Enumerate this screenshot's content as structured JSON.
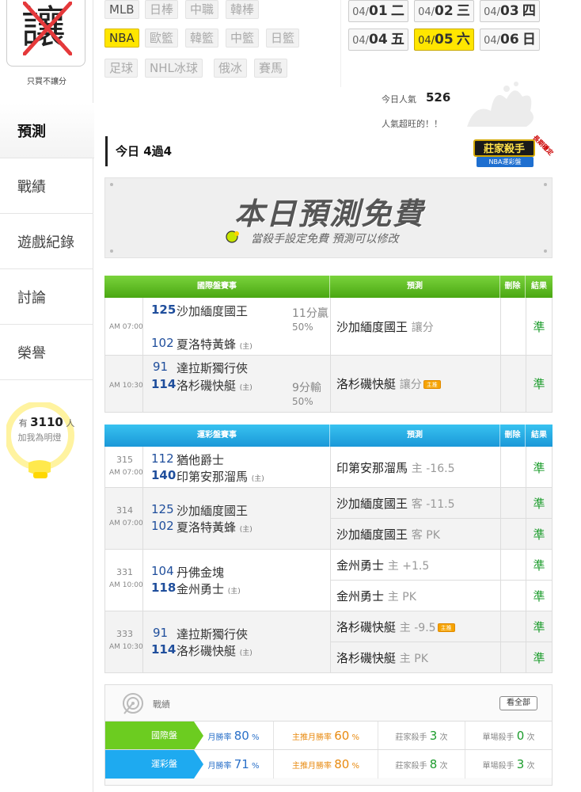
{
  "sidebar": {
    "logo_char": "讓",
    "logo_caption": "只買不讓分",
    "nav": [
      "預測",
      "戰績",
      "遊戲紀錄",
      "討論",
      "榮譽"
    ],
    "fans_prefix": "有",
    "fans_count": "3110",
    "fans_suffix": "人",
    "fans_caption": "加我為明燈"
  },
  "sports": {
    "row1": [
      "MLB",
      "日棒",
      "中職",
      "韓棒"
    ],
    "row2": [
      "NBA",
      "歐籃",
      "韓籃",
      "中籃",
      "日籃"
    ],
    "row3": [
      "足球",
      "NHL冰球",
      "俄冰",
      "賽馬"
    ],
    "active": "NBA"
  },
  "dates": [
    {
      "md": "04/",
      "d": "01",
      "w": "二"
    },
    {
      "md": "04/",
      "d": "02",
      "w": "三"
    },
    {
      "md": "04/",
      "d": "03",
      "w": "四"
    },
    {
      "md": "04/",
      "d": "04",
      "w": "五"
    },
    {
      "md": "04/",
      "d": "05",
      "w": "六"
    },
    {
      "md": "04/",
      "d": "06",
      "w": "日"
    }
  ],
  "popularity": {
    "label": "今日人氣",
    "value": "526",
    "sub": "人氣超旺的！！"
  },
  "today_title": "今日 4過4",
  "badge": {
    "title": "莊家殺手",
    "sub": "NBA運彩盤",
    "ribbon": "長期穩定"
  },
  "banner": {
    "title": "本日預測免費",
    "sub": "當殺手設定免費 預測可以修改"
  },
  "intl_table": {
    "headers": [
      "國際盤賽事",
      "預測",
      "刪除",
      "結果"
    ],
    "rows": [
      {
        "time": "AM 07:00",
        "top_num": "125",
        "top_team": "沙加緬度國王",
        "line": "11分贏",
        "pct": "50%",
        "bot_num": "102",
        "bot_team": "夏洛特黃蜂",
        "home": "(主)",
        "pick": "沙加緬度國王",
        "pick_sub": "讓分",
        "result": "準"
      },
      {
        "time": "AM 10:30",
        "top_num": "91",
        "top_team": "達拉斯獨行俠",
        "line": "9分輸",
        "pct": "50%",
        "bot_num": "114",
        "bot_team": "洛杉磯快艇",
        "home": "(主)",
        "pick": "洛杉磯快艇",
        "pick_sub": "讓分",
        "hot": "主推",
        "result": "準"
      }
    ]
  },
  "sport_table": {
    "headers": [
      "運彩盤賽事",
      "預測",
      "刪除",
      "結果"
    ],
    "games": [
      {
        "id": "315",
        "time": "AM 07:00",
        "top_num": "112",
        "top_team": "猶他爵士",
        "bot_num": "140",
        "bot_team": "印第安那溜馬",
        "home": "(主)",
        "picks": [
          {
            "team": "印第安那溜馬",
            "sub": "主 -16.5",
            "result": "準"
          }
        ]
      },
      {
        "id": "314",
        "time": "AM 07:00",
        "top_num": "125",
        "top_team": "沙加緬度國王",
        "bot_num": "102",
        "bot_team": "夏洛特黃蜂",
        "home": "(主)",
        "picks": [
          {
            "team": "沙加緬度國王",
            "sub": "客 -11.5",
            "result": "準"
          },
          {
            "team": "沙加緬度國王",
            "sub": "客 PK",
            "result": "準"
          }
        ]
      },
      {
        "id": "331",
        "time": "AM 10:00",
        "top_num": "104",
        "top_team": "丹佛金塊",
        "bot_num": "118",
        "bot_team": "金州勇士",
        "home": "(主)",
        "picks": [
          {
            "team": "金州勇士",
            "sub": "主 +1.5",
            "result": "準"
          },
          {
            "team": "金州勇士",
            "sub": "主 PK",
            "result": "準"
          }
        ]
      },
      {
        "id": "333",
        "time": "AM 10:30",
        "top_num": "91",
        "top_team": "達拉斯獨行俠",
        "bot_num": "114",
        "bot_team": "洛杉磯快艇",
        "home": "(主)",
        "picks": [
          {
            "team": "洛杉磯快艇",
            "sub": "主 -9.5",
            "hot": "主推",
            "result": "準"
          },
          {
            "team": "洛杉磯快艇",
            "sub": "主 PK",
            "result": "準"
          }
        ]
      }
    ]
  },
  "stats": {
    "title": "戰績",
    "view_all": "看全部",
    "rows": [
      {
        "label": "國際盤",
        "month_label": "月勝率",
        "month": "80",
        "main_label": "主推月勝率",
        "main": "60",
        "killer_label": "莊家殺手",
        "killer": "3",
        "single_label": "單場殺手",
        "single": "0",
        "pct": "%",
        "times": "次"
      },
      {
        "label": "運彩盤",
        "month_label": "月勝率",
        "month": "71",
        "main_label": "主推月勝率",
        "main": "80",
        "killer_label": "莊家殺手",
        "killer": "8",
        "single_label": "單場殺手",
        "single": "3",
        "pct": "%",
        "times": "次"
      }
    ]
  },
  "colors": {
    "accent_yellow": "#ffe600",
    "intl_green": "#4aa712",
    "sport_blue": "#1a98d8",
    "result_green": "#1c9c2c"
  },
  "icons": [
    "crossed-out-logo",
    "lightbulb-icon",
    "target-icon",
    "smile-icon",
    "hot-tag-icon"
  ]
}
